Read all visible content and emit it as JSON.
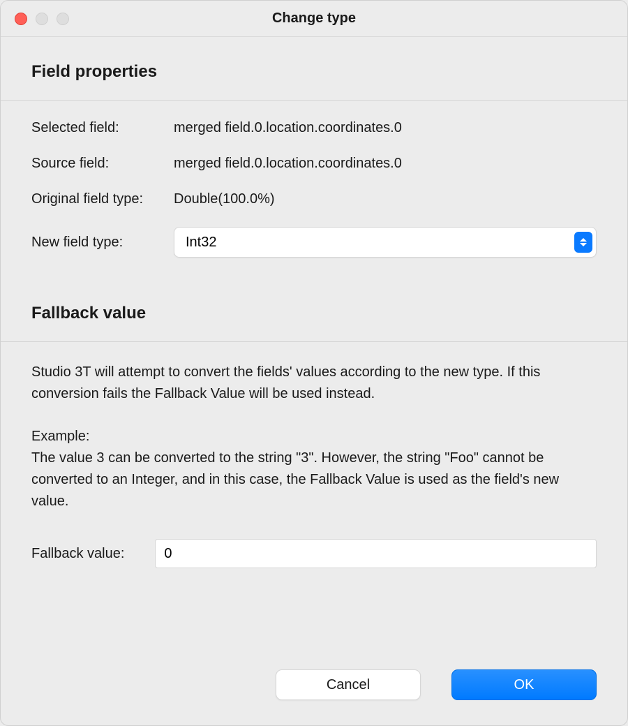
{
  "window": {
    "title": "Change type"
  },
  "sections": {
    "field_properties_header": "Field properties",
    "fallback_value_header": "Fallback value"
  },
  "fields": {
    "selected_field_label": "Selected field:",
    "selected_field_value": "merged field.0.location.coordinates.0",
    "source_field_label": "Source field:",
    "source_field_value": "merged field.0.location.coordinates.0",
    "original_type_label": "Original field type:",
    "original_type_value": "Double(100.0%)",
    "new_type_label": "New field type:",
    "new_type_value": "Int32"
  },
  "fallback": {
    "description_part1": "Studio 3T will attempt to convert the fields' values according to the new type. If this conversion fails the Fallback Value will be used instead.",
    "example_label": "Example:",
    "example_text": "The value 3 can be converted to the string \"3\". However, the string \"Foo\" cannot be converted to an Integer, and in this case, the Fallback Value is used as the field's new value.",
    "input_label": "Fallback value:",
    "input_value": "0"
  },
  "buttons": {
    "cancel": "Cancel",
    "ok": "OK"
  }
}
